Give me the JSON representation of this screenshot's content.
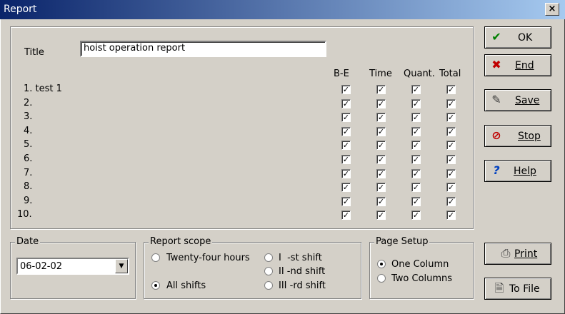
{
  "window": {
    "title": "Report",
    "close_label": "×"
  },
  "report": {
    "title_label": "Title",
    "title_value": "hoist operation report",
    "columns": [
      "B-E",
      "Time",
      "Quant.",
      "Total"
    ],
    "rows": [
      {
        "label": "1. test 1",
        "checks": [
          true,
          true,
          true,
          true
        ]
      },
      {
        "label": "2.",
        "checks": [
          true,
          true,
          true,
          true
        ]
      },
      {
        "label": "3.",
        "checks": [
          true,
          true,
          true,
          true
        ]
      },
      {
        "label": "4.",
        "checks": [
          true,
          true,
          true,
          true
        ]
      },
      {
        "label": "5.",
        "checks": [
          true,
          true,
          true,
          true
        ]
      },
      {
        "label": "6.",
        "checks": [
          true,
          true,
          true,
          true
        ]
      },
      {
        "label": "7.",
        "checks": [
          true,
          true,
          true,
          true
        ]
      },
      {
        "label": "8.",
        "checks": [
          true,
          true,
          true,
          true
        ]
      },
      {
        "label": "9.",
        "checks": [
          true,
          true,
          true,
          true
        ]
      },
      {
        "label": "10.",
        "checks": [
          true,
          true,
          true,
          true
        ]
      }
    ]
  },
  "date": {
    "legend": "Date",
    "value": "06-02-02"
  },
  "scope": {
    "legend": "Report scope",
    "twenty_four": "Twenty-four hours",
    "all_shifts": "All shifts",
    "first_shift": "I  -st shift",
    "second_shift": "II -nd shift",
    "third_shift": "III -rd shift",
    "selected": "all_shifts"
  },
  "page_setup": {
    "legend": "Page Setup",
    "one_column": "One Column",
    "two_columns": "Two Columns",
    "selected": "one_column"
  },
  "buttons": {
    "ok": "OK",
    "end": "End",
    "save": "Save",
    "stop": "Stop",
    "help": "Help",
    "print": "Print",
    "to_file": "To File"
  },
  "icons": {
    "ok": "checkmark-icon",
    "end": "x-icon",
    "save": "pencil-icon",
    "stop": "no-entry-icon",
    "help": "question-icon",
    "print": "printer-icon",
    "to_file": "file-icon"
  },
  "colors": {
    "titlebar_start": "#0a246a",
    "titlebar_end": "#a6caf0",
    "face": "#d4d0c8",
    "ok_icon": "#008000",
    "end_icon": "#c00000",
    "stop_icon": "#c00000",
    "help_icon": "#0040c0"
  }
}
